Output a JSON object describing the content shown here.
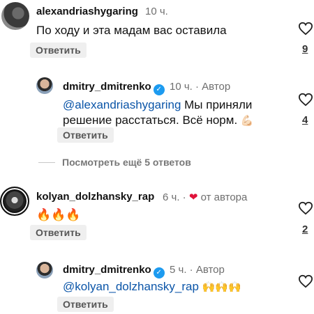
{
  "comments": [
    {
      "username": "alexandriashygaring",
      "time": "10 ч.",
      "text": "По ходу и эта мадам вас оставила",
      "reply_label": "Ответить",
      "likes": "9"
    },
    {
      "username": "dmitry_dmitrenko",
      "time": "10 ч.",
      "author_tag": "· Автор",
      "mention": "@alexandriashygaring",
      "text_after_mention": " Мы приняли",
      "text_line2": "решение расстаться. Всё норм.",
      "emoji": "💪🏻",
      "reply_label": "Ответить",
      "likes": "4"
    },
    {
      "username": "kolyan_dolzhansky_rap",
      "time": "6 ч.",
      "liked_by_author": "от автора",
      "text": "🔥🔥🔥",
      "reply_label": "Ответить",
      "likes": "2"
    },
    {
      "username": "dmitry_dmitrenko",
      "time": "5 ч.",
      "author_tag": "· Автор",
      "mention": "@kolyan_dolzhansky_rap",
      "emoji": "🙌🙌🙌",
      "reply_label": "Ответить"
    }
  ],
  "view_more": "Посмотреть ещё 5 ответов",
  "colors": {
    "mention": "#0b55a8",
    "verified": "#1d9bf0",
    "heart": "#e0123a"
  },
  "icons": {
    "like": "heart-outline-icon",
    "verified": "verified-badge-icon",
    "author_like": "red-heart-icon"
  }
}
